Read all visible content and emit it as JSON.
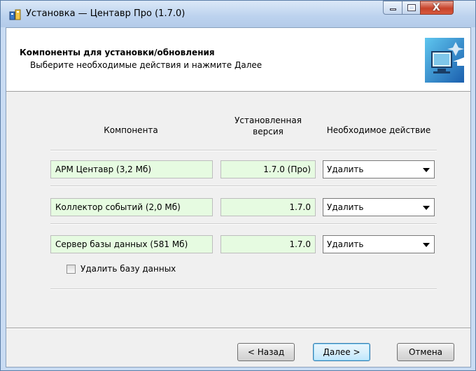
{
  "window": {
    "title": "Установка — Центавр Про (1.7.0)",
    "controls": {
      "minimize": "minimize-icon",
      "maximize": "maximize-icon",
      "close": "X"
    }
  },
  "header": {
    "title": "Компоненты для установки/обновления",
    "subtitle": "Выберите необходимые действия и нажмите Далее",
    "icon": "computer-arrow-icon"
  },
  "columns": {
    "component": "Компонента",
    "version_line1": "Установленная",
    "version_line2": "версия",
    "action": "Необходимое действие"
  },
  "components": [
    {
      "name": "АРМ Центавр (3,2 Мб)",
      "version": "1.7.0 (Про)",
      "action": "Удалить"
    },
    {
      "name": "Коллектор событий (2,0 Мб)",
      "version": "1.7.0",
      "action": "Удалить"
    },
    {
      "name": "Сервер базы данных (581 Мб)",
      "version": "1.7.0",
      "action": "Удалить"
    }
  ],
  "delete_db": {
    "label": "Удалить базу данных",
    "checked": false
  },
  "buttons": {
    "back": "< Назад",
    "next": "Далее >",
    "cancel": "Отмена"
  },
  "colors": {
    "field_bg": "#e6fbe1",
    "title_bar": "#c9dcf3",
    "close_button": "#c7432b"
  }
}
